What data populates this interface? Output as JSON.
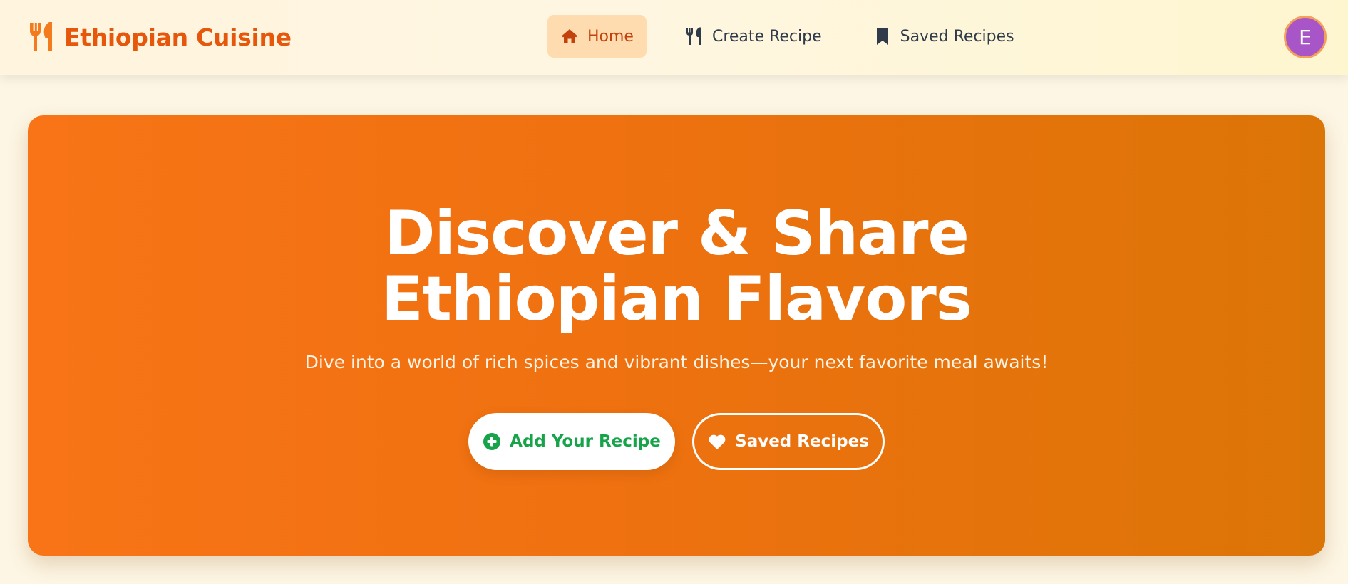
{
  "header": {
    "brand": {
      "name": "Ethiopian Cuisine",
      "icon": "utensils-icon",
      "color": "#e6570c"
    },
    "nav": [
      {
        "label": "Home",
        "icon": "home-icon",
        "active": true
      },
      {
        "label": "Create Recipe",
        "icon": "utensils-icon",
        "active": false
      },
      {
        "label": "Saved Recipes",
        "icon": "bookmark-icon",
        "active": false
      }
    ],
    "avatar": {
      "initial": "E",
      "color": "#a855c7"
    }
  },
  "hero": {
    "title_line1": "Discover & Share",
    "title_line2": "Ethiopian Flavors",
    "subtitle": "Dive into a world of rich spices and vibrant dishes—your next favorite meal awaits!",
    "primary_button": {
      "label": "Add Your Recipe",
      "icon": "plus-circle-icon",
      "color": "#16a34a"
    },
    "secondary_button": {
      "label": "Saved Recipes",
      "icon": "heart-icon"
    }
  },
  "colors": {
    "accent": "#f87416",
    "background": "#fdf6e4",
    "active_nav_bg": "#ffdcb0"
  }
}
